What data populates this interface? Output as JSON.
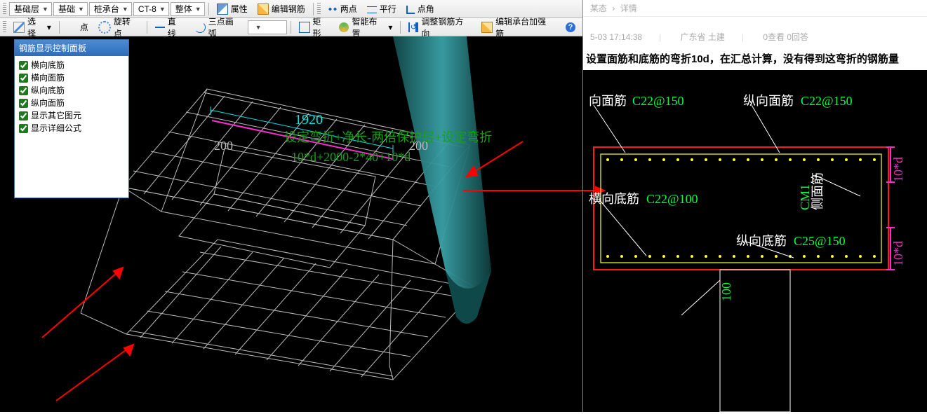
{
  "toolbar1": {
    "combo_layer": "基础层",
    "combo_type": "基础",
    "combo_pile": "桩承台",
    "combo_id": "CT-8",
    "combo_whole": "整体",
    "prop": "属性",
    "edit": "编辑钢筋",
    "draw_two": "两点",
    "draw_para": "平行",
    "draw_corner": "点角"
  },
  "toolbar2": {
    "select": "选择",
    "point": "点",
    "rotpt": "旋转点",
    "line": "直线",
    "arc3": "三点画弧",
    "rect": "矩形",
    "smart": "智能布置",
    "adjust": "调整钢筋方向",
    "strengthen": "编辑承台加强筋"
  },
  "panel": {
    "title": "钢筋显示控制面板",
    "items": [
      "横向底筋",
      "横向面筋",
      "纵向底筋",
      "纵向面筋",
      "显示其它图元",
      "显示详细公式"
    ]
  },
  "viewport_text": {
    "t1920": "1920",
    "t200a": "200",
    "t200b": "200",
    "line1": "设定弯折+净长-两倍保护层+设定弯折",
    "line2": "10*d+2000-2*40+10*d"
  },
  "web": {
    "crumb_a": "某态",
    "crumb_b": "详情",
    "meta_time": "5-03 17:14:38",
    "meta_loc": "广东省 土建",
    "meta_view": "0查看 0回答",
    "headline": "设置面筋和底筋的弯折10d，在汇总计算，没有得到这弯折的钢筋量"
  },
  "rlabels": {
    "a": "向面筋",
    "av": "C22@150",
    "b": "纵向面筋",
    "bv": "C22@150",
    "c": "横向底筋",
    "cv": "C22@100",
    "d": "纵向底筋",
    "dv": "C25@150",
    "side": "侧面筋",
    "side2": "CM1",
    "ten1": "10*d",
    "ten2": "10*d",
    "h100": "100"
  }
}
